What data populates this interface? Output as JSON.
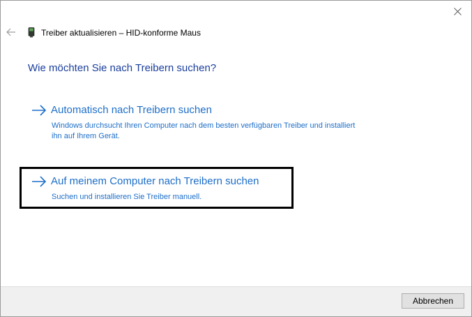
{
  "window": {
    "close_icon": "close-icon"
  },
  "header": {
    "back_icon": "back-arrow-icon",
    "device_icon": "mouse-device-icon",
    "title": "Treiber aktualisieren – HID-konforme Maus"
  },
  "main": {
    "question": "Wie möchten Sie nach Treibern suchen?",
    "options": [
      {
        "title": "Automatisch nach Treibern suchen",
        "description": "Windows durchsucht Ihren Computer nach dem besten verfügbaren Treiber und installiert ihn auf Ihrem Gerät."
      },
      {
        "title": "Auf meinem Computer nach Treibern suchen",
        "description": "Suchen und installieren Sie Treiber manuell."
      }
    ]
  },
  "footer": {
    "cancel_label": "Abbrechen"
  },
  "colors": {
    "link": "#1d6ec8",
    "heading": "#1a3e9c",
    "footer_bg": "#f0f0f0",
    "highlight": "#000000"
  }
}
